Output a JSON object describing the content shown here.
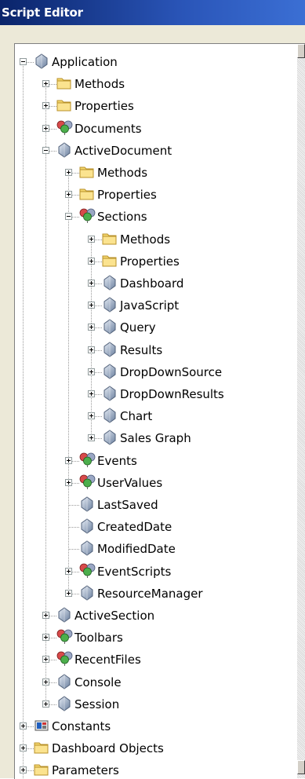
{
  "window": {
    "title": "Script Editor"
  },
  "tree": [
    {
      "label": "Application",
      "icon": "sphere-icon",
      "level": 0,
      "expander": "minus"
    },
    {
      "label": "Methods",
      "icon": "folder-icon",
      "level": 1,
      "expander": "plus"
    },
    {
      "label": "Properties",
      "icon": "folder-icon",
      "level": 1,
      "expander": "plus"
    },
    {
      "label": "Documents",
      "icon": "collection-icon",
      "level": 1,
      "expander": "plus"
    },
    {
      "label": "ActiveDocument",
      "icon": "sphere-icon",
      "level": 1,
      "expander": "minus"
    },
    {
      "label": "Methods",
      "icon": "folder-icon",
      "level": 2,
      "expander": "plus"
    },
    {
      "label": "Properties",
      "icon": "folder-icon",
      "level": 2,
      "expander": "plus"
    },
    {
      "label": "Sections",
      "icon": "collection-icon",
      "level": 2,
      "expander": "minus"
    },
    {
      "label": "Methods",
      "icon": "folder-icon",
      "level": 3,
      "expander": "plus"
    },
    {
      "label": "Properties",
      "icon": "folder-icon",
      "level": 3,
      "expander": "plus"
    },
    {
      "label": "Dashboard",
      "icon": "sphere-icon",
      "level": 3,
      "expander": "plus"
    },
    {
      "label": "JavaScript",
      "icon": "sphere-icon",
      "level": 3,
      "expander": "plus"
    },
    {
      "label": "Query",
      "icon": "sphere-icon",
      "level": 3,
      "expander": "plus"
    },
    {
      "label": "Results",
      "icon": "sphere-icon",
      "level": 3,
      "expander": "plus"
    },
    {
      "label": "DropDownSource",
      "icon": "sphere-icon",
      "level": 3,
      "expander": "plus"
    },
    {
      "label": "DropDownResults",
      "icon": "sphere-icon",
      "level": 3,
      "expander": "plus"
    },
    {
      "label": "Chart",
      "icon": "sphere-icon",
      "level": 3,
      "expander": "plus"
    },
    {
      "label": "Sales Graph",
      "icon": "sphere-icon",
      "level": 3,
      "expander": "plus"
    },
    {
      "label": "Events",
      "icon": "collection-icon",
      "level": 2,
      "expander": "plus"
    },
    {
      "label": "UserValues",
      "icon": "collection-icon",
      "level": 2,
      "expander": "plus"
    },
    {
      "label": "LastSaved",
      "icon": "sphere-icon",
      "level": 2,
      "expander": "none"
    },
    {
      "label": "CreatedDate",
      "icon": "sphere-icon",
      "level": 2,
      "expander": "none"
    },
    {
      "label": "ModifiedDate",
      "icon": "sphere-icon",
      "level": 2,
      "expander": "none"
    },
    {
      "label": "EventScripts",
      "icon": "collection-icon",
      "level": 2,
      "expander": "plus"
    },
    {
      "label": "ResourceManager",
      "icon": "sphere-icon",
      "level": 2,
      "expander": "plus"
    },
    {
      "label": "ActiveSection",
      "icon": "sphere-icon",
      "level": 1,
      "expander": "plus"
    },
    {
      "label": "Toolbars",
      "icon": "collection-icon",
      "level": 1,
      "expander": "plus"
    },
    {
      "label": "RecentFiles",
      "icon": "collection-icon",
      "level": 1,
      "expander": "plus"
    },
    {
      "label": "Console",
      "icon": "sphere-icon",
      "level": 1,
      "expander": "plus"
    },
    {
      "label": "Session",
      "icon": "sphere-icon",
      "level": 1,
      "expander": "plus"
    },
    {
      "label": "Constants",
      "icon": "constants-icon",
      "level": 0,
      "expander": "plus"
    },
    {
      "label": "Dashboard Objects",
      "icon": "folder-icon",
      "level": 0,
      "expander": "plus"
    },
    {
      "label": "Parameters",
      "icon": "folder-icon",
      "level": 0,
      "expander": "plus"
    }
  ]
}
